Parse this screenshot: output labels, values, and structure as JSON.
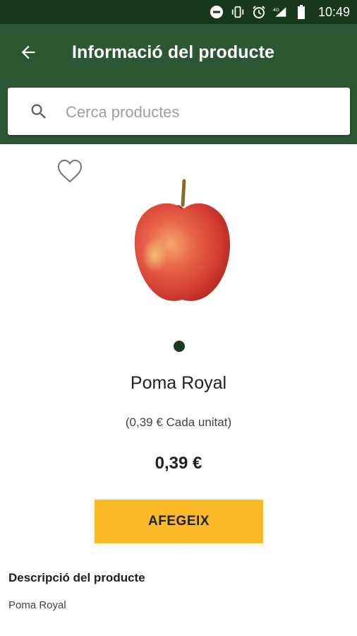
{
  "status_bar": {
    "time": "10:49",
    "icons": [
      "do-not-disturb-icon",
      "vibrate-icon",
      "alarm-icon",
      "4g-signal-icon",
      "battery-icon"
    ]
  },
  "app_bar": {
    "title": "Informació del producte",
    "back_icon": "arrow-left-icon"
  },
  "search": {
    "placeholder": "Cerca productes",
    "value": ""
  },
  "product": {
    "favorite_icon": "heart-outline-icon",
    "image": "red apple photo",
    "name": "Poma Royal",
    "unit_price": "(0,39 € Cada unitat)",
    "price": "0,39 €",
    "add_label": "AFEGEIX",
    "add_button_color": "#fbb827"
  },
  "description": {
    "title": "Descripció del producte",
    "text": "Poma Royal"
  },
  "colors": {
    "status_bar": "#17381d",
    "app_bar": "#2b5732",
    "pager_dot": "#163a20"
  }
}
